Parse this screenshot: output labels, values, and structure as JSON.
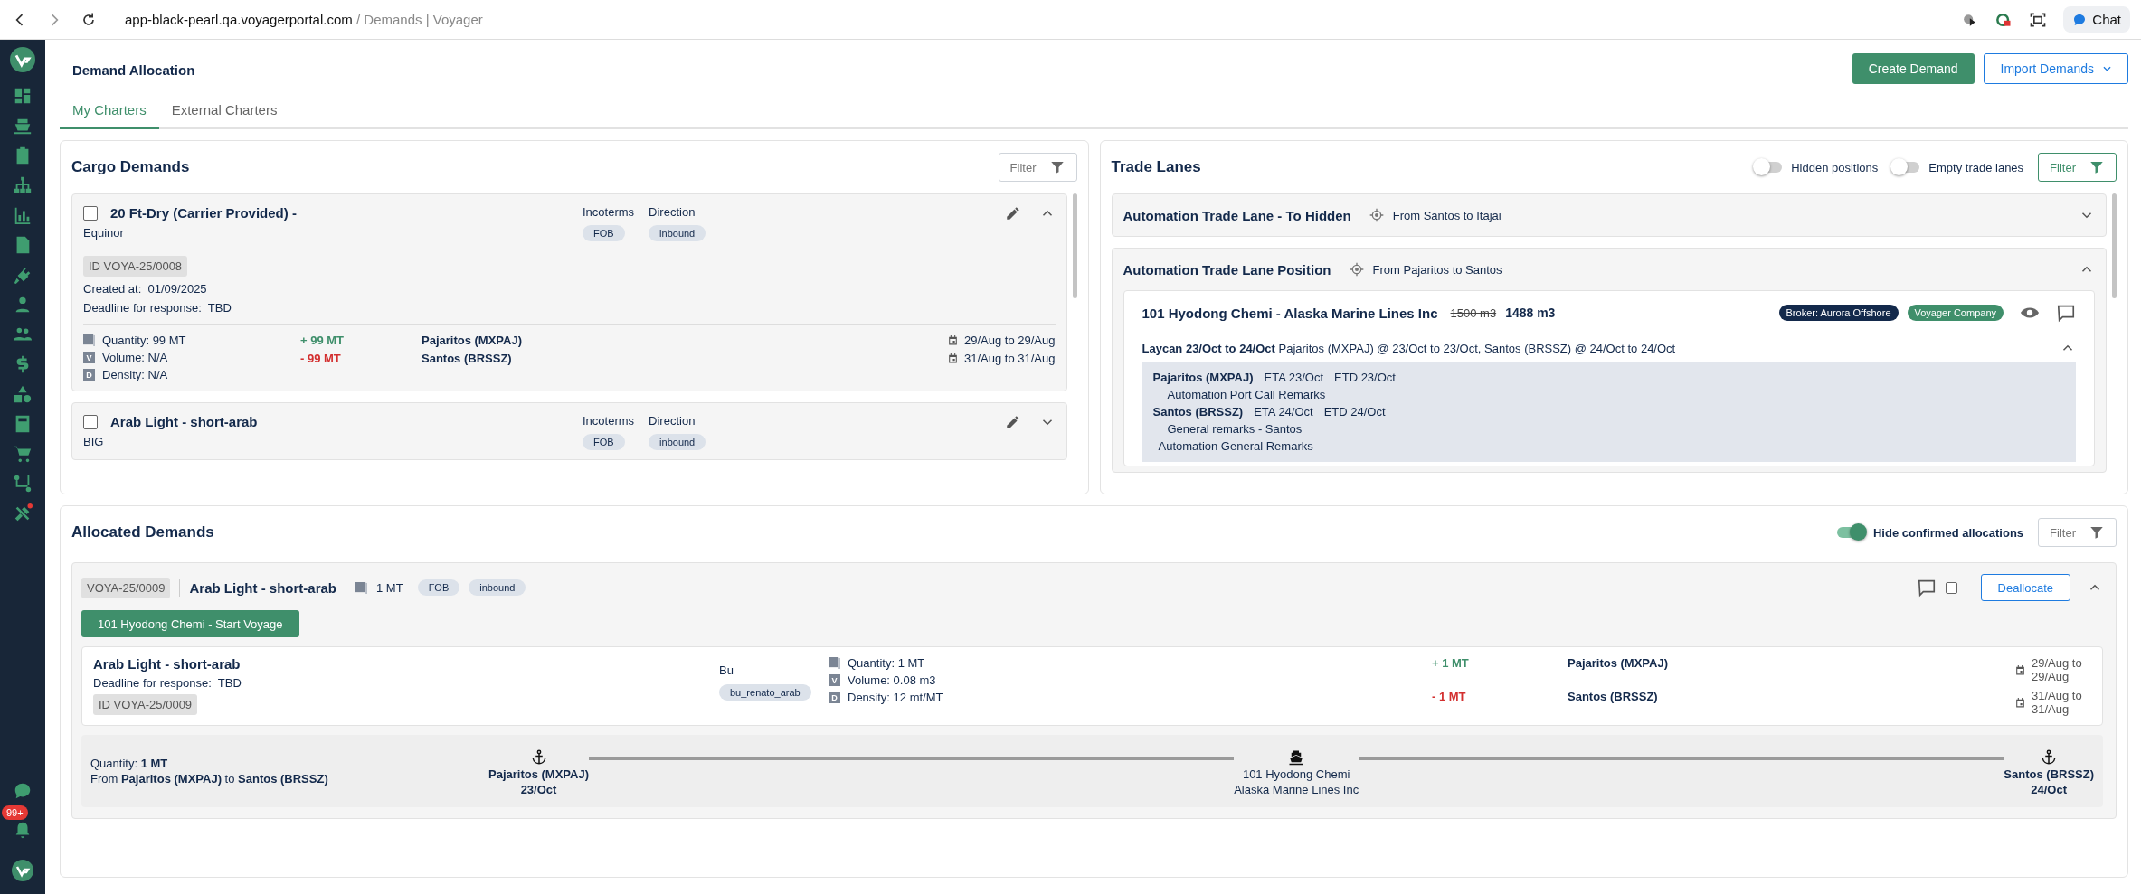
{
  "browser": {
    "host": "app-black-pearl.qa.voyagerportal.com",
    "path": "/ Demands | Voyager",
    "chat": "Chat"
  },
  "sidebar": {
    "notifications_badge": "99+"
  },
  "header": {
    "title": "Demand Allocation",
    "buttons": [
      {
        "label": "Create Demand",
        "kind": "primary"
      },
      {
        "label": "Import Demands",
        "kind": "dropdown"
      }
    ]
  },
  "tabs": [
    {
      "label": "My Charters",
      "selected": true
    },
    {
      "label": "External Charters",
      "selected": false
    }
  ],
  "cargo_demands": {
    "title": "Cargo Demands",
    "filter": "Filter",
    "items": [
      {
        "title": "20 Ft-Dry (Carrier Provided) -",
        "company": "Equinor",
        "checked": false,
        "expanded": true,
        "incoterms_label": "Incoterms",
        "incoterms": "FOB",
        "direction_label": "Direction",
        "direction": "inbound",
        "id": "ID VOYA-25/0008",
        "created_label": "Created at:",
        "created": "01/09/2025",
        "deadline_label": "Deadline for response:",
        "deadline": "TBD",
        "metrics": [
          {
            "kind": "quantity",
            "text": "Quantity: 99 MT"
          },
          {
            "kind": "volume",
            "badge": "V",
            "text": "Volume: N/A"
          },
          {
            "kind": "density",
            "badge": "D",
            "text": "Density: N/A"
          }
        ],
        "loaded": "+ 99 MT",
        "discharged": "- 99 MT",
        "load_port": "Pajaritos (MXPAJ)",
        "discharge_port": "Santos (BRSSZ)",
        "load_dates": "29/Aug to 29/Aug",
        "discharge_dates": "31/Aug to 31/Aug"
      },
      {
        "title": "Arab Light - short-arab",
        "company": "BIG",
        "checked": false,
        "expanded": false,
        "incoterms_label": "Incoterms",
        "incoterms": "FOB",
        "direction_label": "Direction",
        "direction": "inbound"
      }
    ]
  },
  "trade_lanes": {
    "title": "Trade Lanes",
    "toggles": [
      {
        "label": "Hidden positions",
        "on": false
      },
      {
        "label": "Empty trade lanes",
        "on": false
      }
    ],
    "filter": "Filter",
    "lanes": [
      {
        "name": "Automation Trade Lane - To Hidden",
        "route": "From Santos to Itajai",
        "expanded": false
      },
      {
        "name": "Automation Trade Lane Position",
        "route": "From Pajaritos to Santos",
        "expanded": true,
        "positions": [
          {
            "vessel": "101 Hyodong Chemi - Alaska Marine Lines Inc",
            "previous_capacity": "1500 m3",
            "capacity": "1488 m3",
            "tags": [
              {
                "label": "Broker: Aurora Offshore",
                "color": "#13294b"
              },
              {
                "label": "Voyager Company",
                "color": "#3f8f6b"
              }
            ],
            "laycan": "Laycan 23/Oct to 24/Oct",
            "laycan_detail": "Pajaritos (MXPAJ) @ 23/Oct to 23/Oct, Santos (BRSSZ) @ 24/Oct to 24/Oct",
            "expanded": true,
            "port_calls": [
              {
                "port": "Pajaritos (MXPAJ)",
                "eta": "ETA 23/Oct",
                "etd": "ETD 23/Oct",
                "remarks": "Automation Port Call Remarks"
              },
              {
                "port": "Santos (BRSSZ)",
                "eta": "ETA 24/Oct",
                "etd": "ETD 24/Oct",
                "remarks": "General remarks - Santos"
              }
            ],
            "general_remarks": "Automation General Remarks"
          }
        ]
      }
    ]
  },
  "allocated_demands": {
    "title": "Allocated Demands",
    "toggle": {
      "label": "Hide confirmed allocations",
      "on": true
    },
    "filter": "Filter",
    "allocations": [
      {
        "id": "VOYA-25/0009",
        "name": "Arab Light - short-arab",
        "quantity": "1 MT",
        "tags": [
          "FOB",
          "inbound"
        ],
        "voyage_button": "101 Hyodong Chemi - Start Voyage",
        "checked": false,
        "action": "Deallocate",
        "expanded": true,
        "detail": {
          "name": "Arab Light - short-arab",
          "deadline_label": "Deadline for response:",
          "deadline": "TBD",
          "id": "ID VOYA-25/0009",
          "bu_label": "Bu",
          "bu": "bu_renato_arab",
          "metrics": [
            {
              "kind": "quantity",
              "text": "Quantity: 1 MT"
            },
            {
              "kind": "volume",
              "badge": "V",
              "text": "Volume: 0.08 m3"
            },
            {
              "kind": "density",
              "badge": "D",
              "text": "Density: 12 mt/MT"
            }
          ],
          "loaded": "+ 1 MT",
          "discharged": "- 1 MT",
          "load_port": "Pajaritos (MXPAJ)",
          "discharge_port": "Santos (BRSSZ)",
          "load_dates": "29/Aug to 29/Aug",
          "discharge_dates": "31/Aug to 31/Aug"
        },
        "route": {
          "quantity": "Quantity: **1 MT**",
          "summary": "From **Pajaritos (MXPAJ)** to **Santos (BRSSZ)**",
          "origin": {
            "port": "Pajaritos (MXPAJ)",
            "date": "23/Oct"
          },
          "vessel": "101 Hyodong Chemi",
          "operator": "Alaska Marine Lines Inc",
          "destination": {
            "port": "Santos (BRSSZ)",
            "date": "24/Oct"
          }
        }
      }
    ]
  }
}
